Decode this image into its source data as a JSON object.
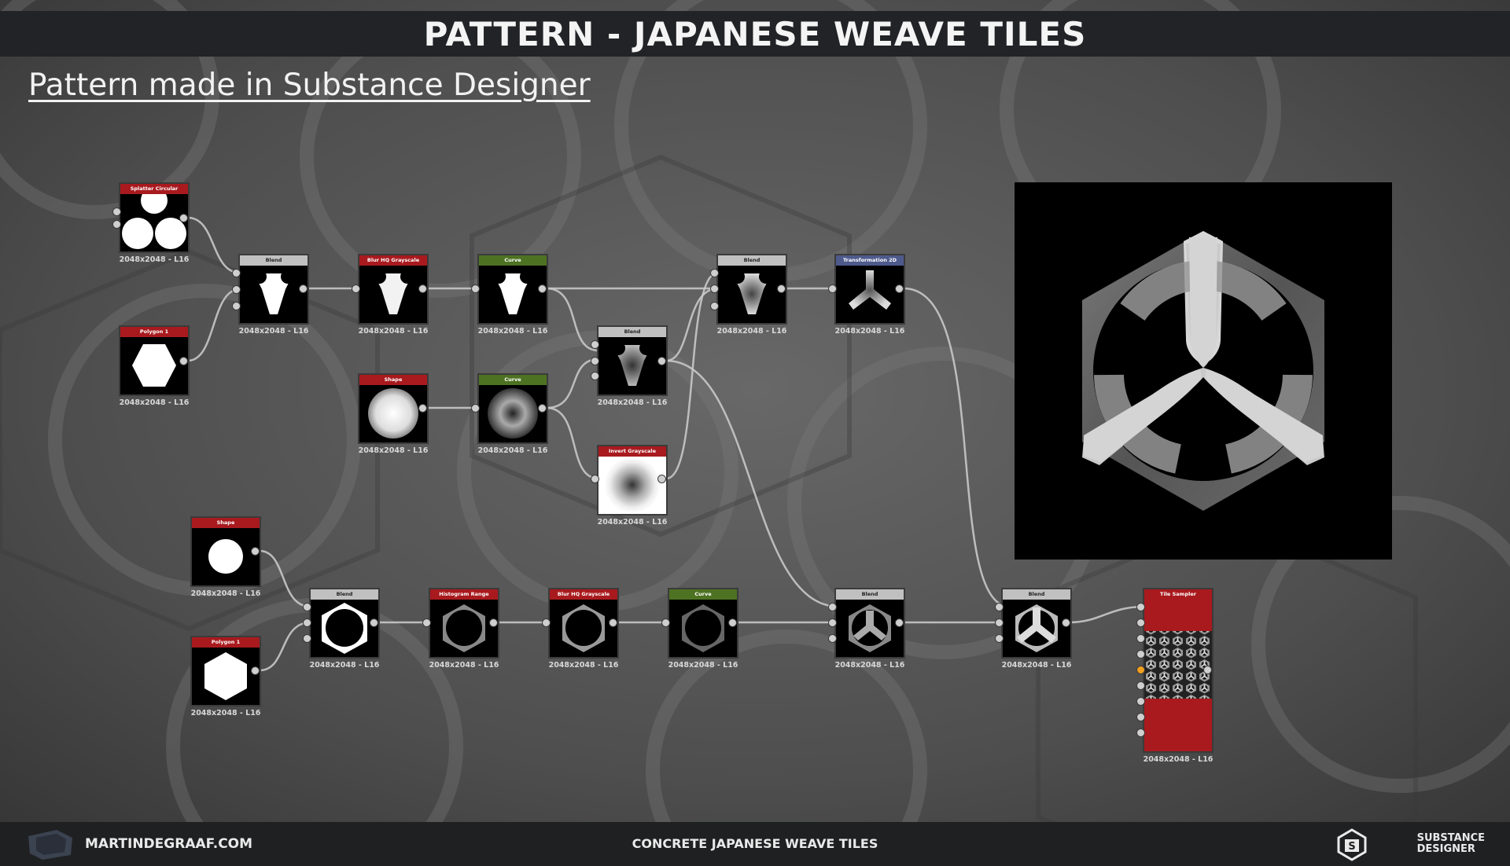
{
  "title": "PATTERN - JAPANESE WEAVE TILES",
  "subtitle": "Pattern made in Substance Designer",
  "footer": {
    "site": "MARTINDEGRAAF.COM",
    "center": "CONCRETE JAPANESE WEAVE TILES",
    "brand_line1": "SUBSTANCE",
    "brand_line2": "DESIGNER"
  },
  "nodes": {
    "splatter": {
      "label": "Splatter Circular",
      "res": "2048x2048 - L16"
    },
    "polygon1": {
      "label": "Polygon 1",
      "res": "2048x2048 - L16"
    },
    "blend1": {
      "label": "Blend",
      "res": "2048x2048 - L16"
    },
    "blurhq1": {
      "label": "Blur HQ Grayscale",
      "res": "2048x2048 - L16"
    },
    "curve1": {
      "label": "Curve",
      "res": "2048x2048 - L16"
    },
    "blend2": {
      "label": "Blend",
      "res": "2048x2048 - L16"
    },
    "transform": {
      "label": "Transformation 2D",
      "res": "2048x2048 - L16"
    },
    "shape1": {
      "label": "Shape",
      "res": "2048x2048 - L16"
    },
    "curve2": {
      "label": "Curve",
      "res": "2048x2048 - L16"
    },
    "blend3": {
      "label": "Blend",
      "res": "2048x2048 - L16"
    },
    "invert": {
      "label": "Invert Grayscale",
      "res": "2048x2048 - L16"
    },
    "shape2": {
      "label": "Shape",
      "res": "2048x2048 - L16"
    },
    "polygon2": {
      "label": "Polygon 1",
      "res": "2048x2048 - L16"
    },
    "blend4": {
      "label": "Blend",
      "res": "2048x2048 - L16"
    },
    "histogram": {
      "label": "Histogram Range",
      "res": "2048x2048 - L16"
    },
    "blurhq2": {
      "label": "Blur HQ Grayscale",
      "res": "2048x2048 - L16"
    },
    "curve3": {
      "label": "Curve",
      "res": "2048x2048 - L16"
    },
    "blend5": {
      "label": "Blend",
      "res": "2048x2048 - L16"
    },
    "blend6": {
      "label": "Blend",
      "res": "2048x2048 - L16"
    },
    "tilesampler": {
      "label": "Tile Sampler",
      "res": "2048x2048 - L16"
    }
  },
  "colors": {
    "header_red": "#a81a1e",
    "header_gray": "#c0c0c0",
    "header_green": "#4d7222",
    "header_blue": "#4e5a8c",
    "title_bar": "#222326",
    "wire": "#c8c8c8"
  }
}
